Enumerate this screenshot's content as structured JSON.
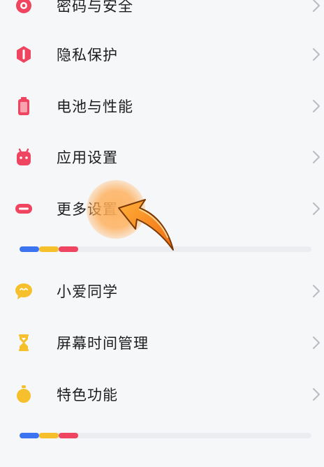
{
  "menu": {
    "items": [
      {
        "label": "密码与安全",
        "icon": "lock-shield-icon",
        "color": "#ef4560"
      },
      {
        "label": "隐私保护",
        "icon": "privacy-shield-icon",
        "color": "#ef4560"
      },
      {
        "label": "电池与性能",
        "icon": "battery-icon",
        "color": "#ef4560"
      },
      {
        "label": "应用设置",
        "icon": "android-app-icon",
        "color": "#ef4560"
      },
      {
        "label": "更多设置",
        "icon": "more-settings-icon",
        "color": "#ef4560"
      },
      {
        "label": "小爱同学",
        "icon": "xiaoai-chat-icon",
        "color": "#f6c02c"
      },
      {
        "label": "屏幕时间管理",
        "icon": "hourglass-icon",
        "color": "#f6c02c"
      },
      {
        "label": "特色功能",
        "icon": "feature-bulb-icon",
        "color": "#f6c02c"
      }
    ]
  },
  "accent_colors": {
    "blue": "#3b73f0",
    "yellow": "#f6c02c",
    "red": "#ef4560"
  }
}
